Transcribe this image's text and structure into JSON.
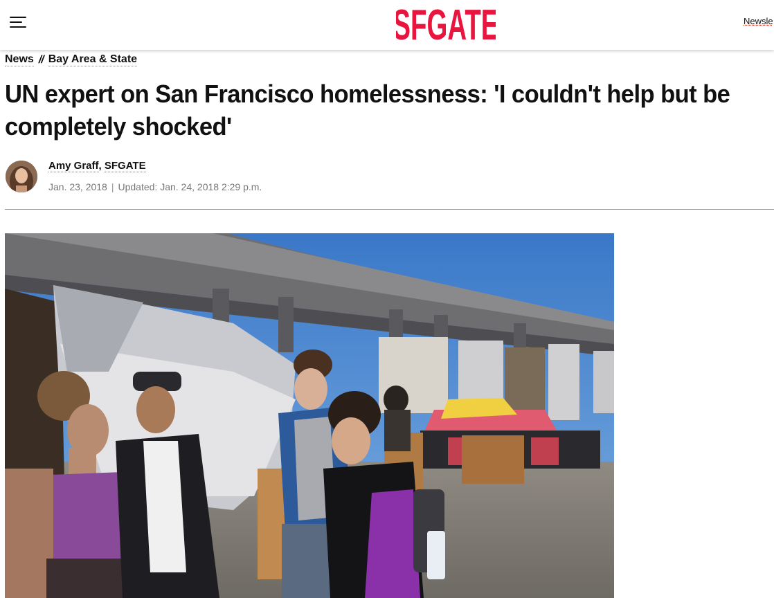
{
  "header": {
    "logo_text": "SFGATE",
    "newsletter_label": "Newsle",
    "brand_color": "#e8153f",
    "menu_icon": "hamburger-menu-icon"
  },
  "breadcrumb": {
    "items": [
      "News",
      "Bay Area & State"
    ],
    "separator": "//"
  },
  "article": {
    "headline": "UN expert on San Francisco homelessness: 'I couldn't help but be completely shocked'",
    "author": "Amy Graff",
    "author_sep": ",",
    "publication": "SFGATE",
    "date": "Jan. 23, 2018",
    "date_sep": "|",
    "updated": "Updated: Jan. 24, 2018 2:29 p.m."
  },
  "colors": {
    "text": "#111111",
    "meta": "#777777",
    "divider": "#9a9a9a"
  }
}
